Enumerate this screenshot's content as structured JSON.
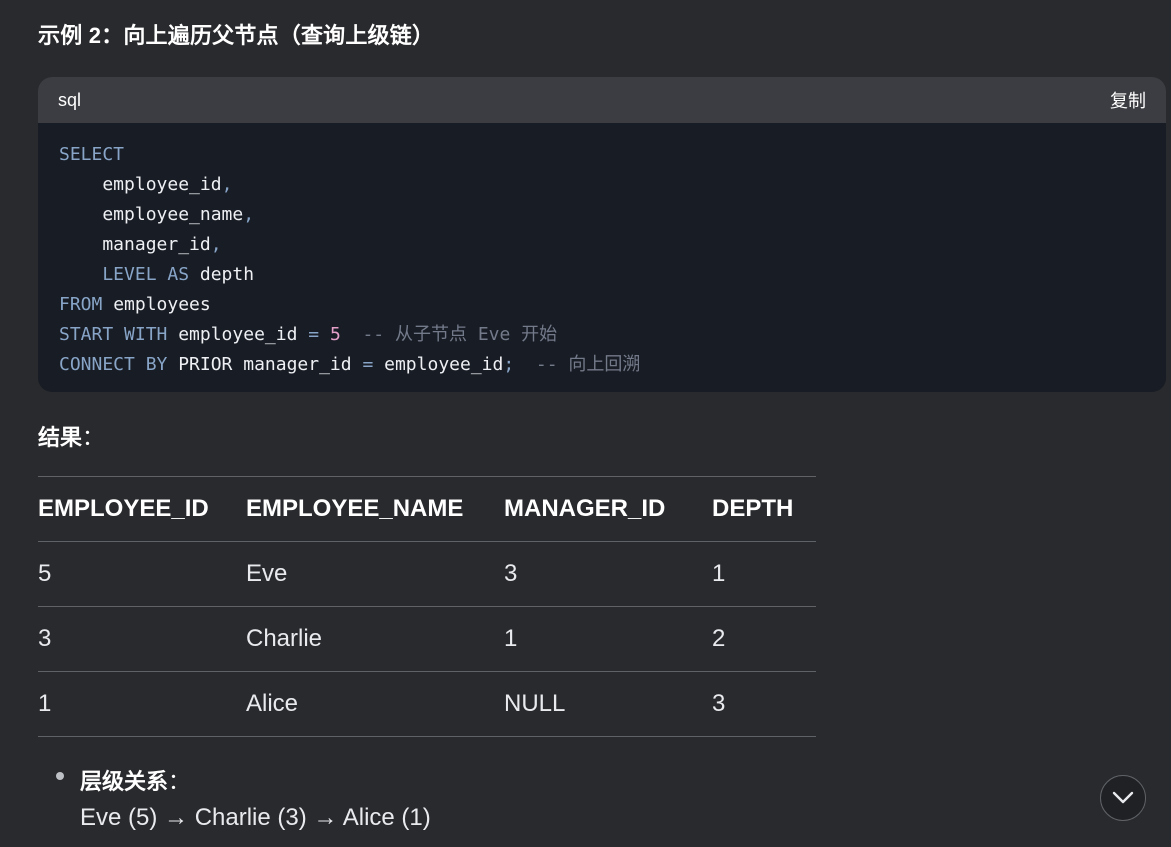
{
  "heading": "示例 2：向上遍历父节点（查询上级链）",
  "code_block": {
    "language": "sql",
    "copy_label": "复制",
    "lines": [
      [
        {
          "t": "SELECT",
          "c": "kw"
        }
      ],
      [
        {
          "t": "    employee_id",
          "c": ""
        },
        {
          "t": ",",
          "c": "op"
        }
      ],
      [
        {
          "t": "    employee_name",
          "c": ""
        },
        {
          "t": ",",
          "c": "op"
        }
      ],
      [
        {
          "t": "    manager_id",
          "c": ""
        },
        {
          "t": ",",
          "c": "op"
        }
      ],
      [
        {
          "t": "    LEVEL AS",
          "c": "kw"
        },
        {
          "t": " depth",
          "c": ""
        }
      ],
      [
        {
          "t": "FROM",
          "c": "kw"
        },
        {
          "t": " employees",
          "c": ""
        }
      ],
      [
        {
          "t": "START WITH",
          "c": "kw"
        },
        {
          "t": " employee_id ",
          "c": ""
        },
        {
          "t": "=",
          "c": "op"
        },
        {
          "t": " ",
          "c": ""
        },
        {
          "t": "5",
          "c": "num"
        },
        {
          "t": "  -- 从子节点 Eve 开始",
          "c": "cm"
        }
      ],
      [
        {
          "t": "CONNECT BY",
          "c": "kw"
        },
        {
          "t": " PRIOR manager_id ",
          "c": ""
        },
        {
          "t": "=",
          "c": "op"
        },
        {
          "t": " employee_id",
          "c": ""
        },
        {
          "t": ";",
          "c": "op"
        },
        {
          "t": "  -- 向上回溯",
          "c": "cm"
        }
      ]
    ]
  },
  "result": {
    "label": "结果",
    "colon": "：",
    "columns": [
      "EMPLOYEE_ID",
      "EMPLOYEE_NAME",
      "MANAGER_ID",
      "DEPTH"
    ],
    "rows": [
      [
        "5",
        "Eve",
        "3",
        "1"
      ],
      [
        "3",
        "Charlie",
        "1",
        "2"
      ],
      [
        "1",
        "Alice",
        "NULL",
        "3"
      ]
    ]
  },
  "hierarchy": {
    "title": "层级关系",
    "colon": "：",
    "text": "Eve (5) → Charlie (3) → Alice (1)"
  },
  "scroll_button": {
    "icon": "chevron-down-icon"
  }
}
